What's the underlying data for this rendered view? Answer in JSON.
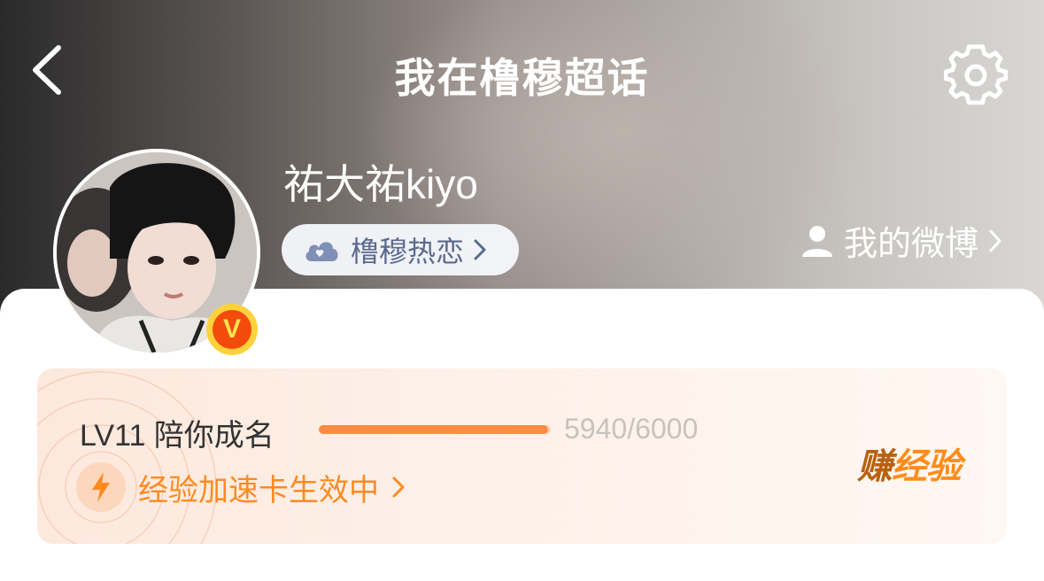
{
  "header": {
    "title": "我在橹穆超话",
    "back_icon": "chevron-left-icon",
    "settings_icon": "gear-icon"
  },
  "profile": {
    "username": "祐大祐kiyo",
    "avatar_badge": "V",
    "badge_color": "#f24b0c",
    "topic_tag": {
      "label": "橹穆热恋",
      "icon": "cloud-heart-icon"
    },
    "my_weibo": {
      "label": "我的微博",
      "icon": "person-icon"
    }
  },
  "experience": {
    "level_label": "LV11 陪你成名",
    "progress_text": "5940/6000",
    "progress_current": 5940,
    "progress_max": 6000,
    "boost_label": "经验加速卡生效中",
    "boost_icon": "lightning-icon",
    "earn_button_part1": "赚",
    "earn_button_part2": "经验",
    "accent_color": "#ff8c42"
  }
}
